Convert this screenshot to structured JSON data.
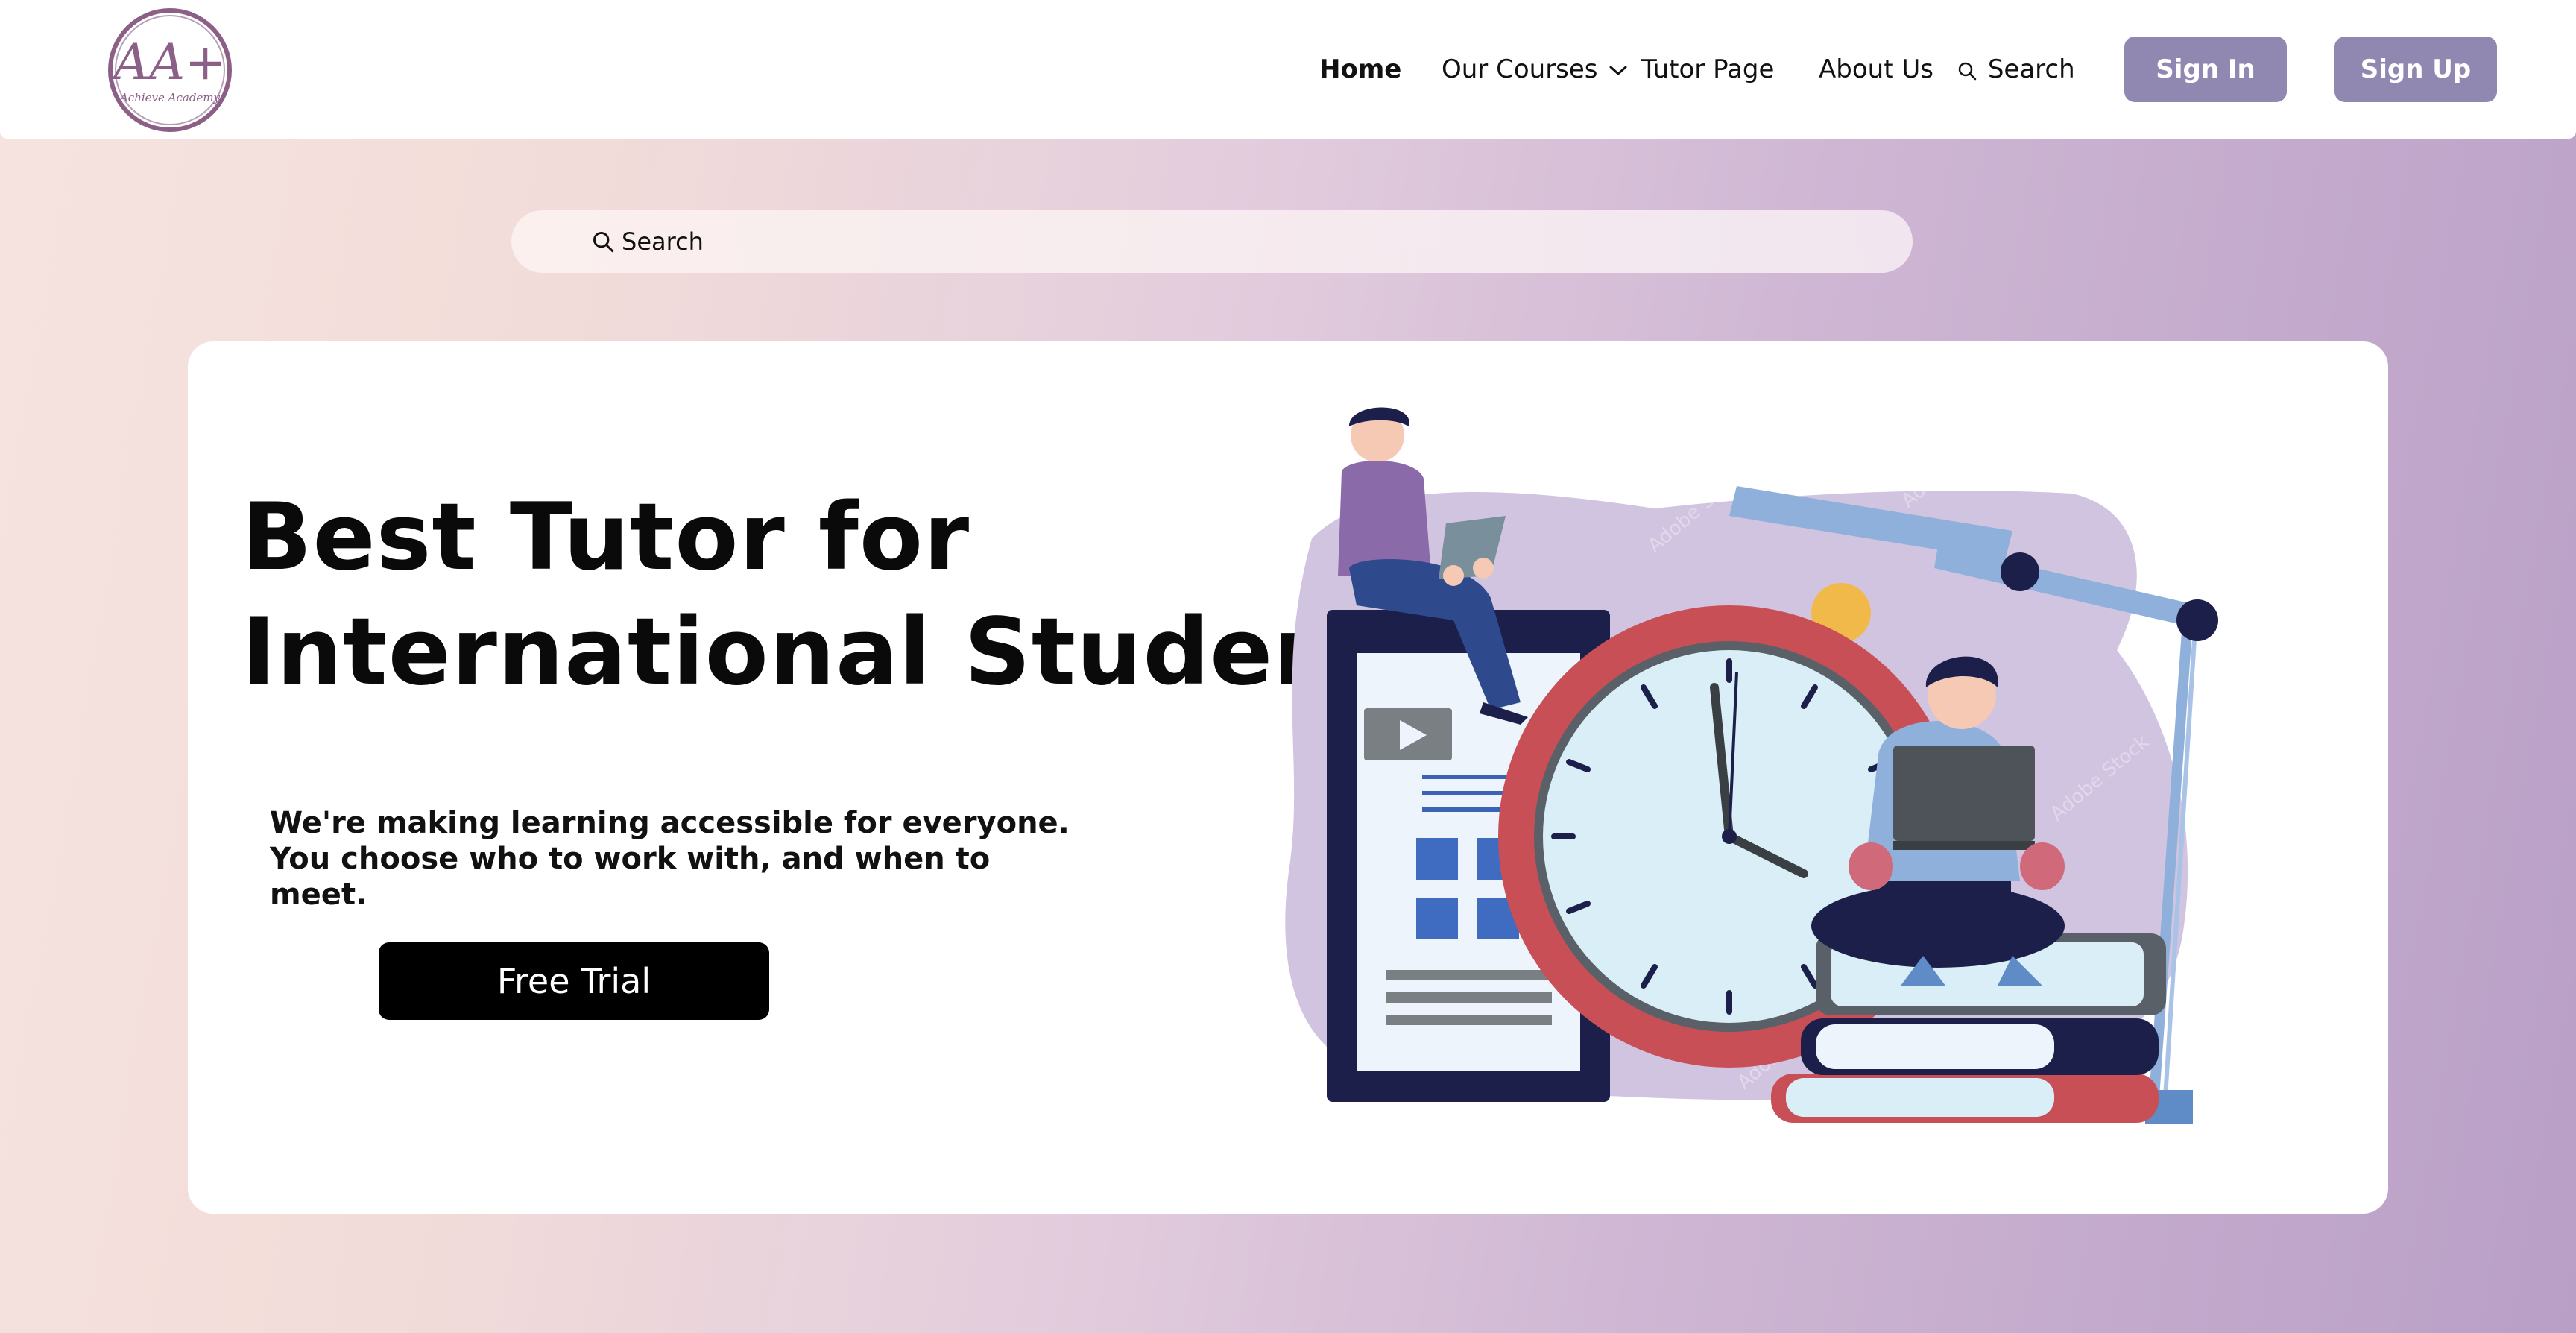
{
  "brand": {
    "logo_text": "AA+",
    "logo_subtext": "Achieve Academy"
  },
  "nav": {
    "home": "Home",
    "courses": "Our Courses",
    "tutor": "Tutor Page",
    "about": "About Us",
    "search": "Search",
    "sign_in": "Sign In",
    "sign_up": "Sign Up"
  },
  "search": {
    "placeholder": "Search"
  },
  "hero": {
    "title_line1": "Best Tutor for",
    "title_line2": "International Student",
    "subtitle": "We're making learning accessible for everyone. You choose who to work with, and when to meet.",
    "cta": "Free Trial",
    "watermark": "Adobe Stock"
  },
  "colors": {
    "accent_button": "#9188b2",
    "cta_background": "#000000",
    "logo_purple": "#8b5f86"
  }
}
